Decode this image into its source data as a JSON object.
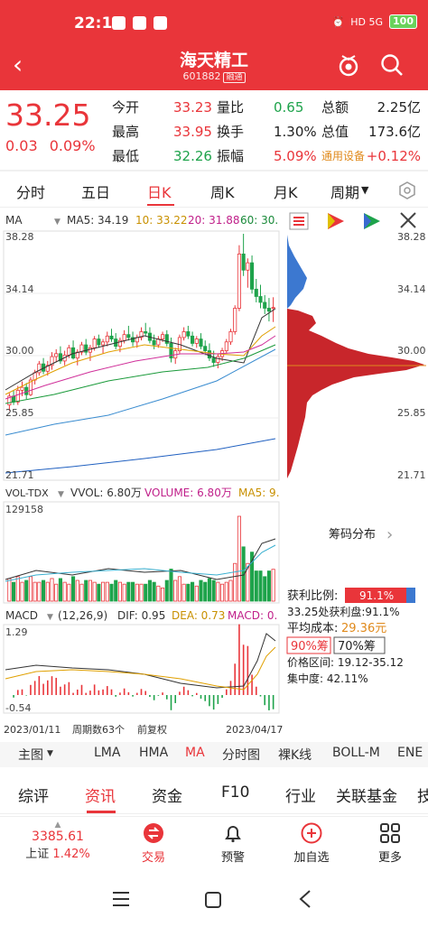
{
  "status": {
    "time": "22:19",
    "net": "HD 5G",
    "battery": "100"
  },
  "header": {
    "title": "海天精工",
    "code": "601882",
    "tag": "融通"
  },
  "quote": {
    "price": "33.25",
    "change": "0.03",
    "change_pct": "0.09%",
    "rows": [
      {
        "l1": "今开",
        "v1": "33.23",
        "l2": "量比",
        "v2": "0.65",
        "l3": "总额",
        "v3": "2.25亿"
      },
      {
        "l1": "最高",
        "v1": "33.95",
        "l2": "换手",
        "v2": "1.30%",
        "l3": "总值",
        "v3": "173.6亿"
      },
      {
        "l1": "最低",
        "v1": "32.26",
        "l2": "振幅",
        "v2": "5.09%",
        "l3": "通用设备",
        "v3": "+0.12%"
      }
    ]
  },
  "period_tabs": [
    "分时",
    "五日",
    "日K",
    "周K",
    "月K",
    "周期"
  ],
  "period_active": "日K",
  "ma_legend": {
    "label": "MA",
    "ma5": "MA5: 34.19",
    "ma10": "10: 33.22",
    "ma20": "20: 31.88",
    "ma60": "60: 30."
  },
  "price_axis": [
    "38.28",
    "34.14",
    "30.00",
    "25.85",
    "21.71"
  ],
  "vol_legend": {
    "label": "VOL-TDX",
    "vvol": "VVOL: 6.80万",
    "volume": "VOLUME: 6.80万",
    "ma5": "MA5: 9."
  },
  "vol_max": "129158",
  "macd_legend": {
    "label": "MACD",
    "params": "(12,26,9)",
    "dif": "DIF: 0.95",
    "dea": "DEA: 0.73",
    "macd": "MACD: 0."
  },
  "macd_axis": [
    "1.29",
    "-0.54"
  ],
  "date_axis": {
    "start": "2023/01/11",
    "period": "周期数63个",
    "adj": "前复权",
    "end": "2023/04/17"
  },
  "chip": {
    "title": "筹码分布",
    "ratio_label": "获利比例:",
    "ratio_value": "91.1%",
    "profit_line": "33.25处获利盘:91.1%",
    "avg_label": "平均成本:",
    "avg_value": "29.36元",
    "chip90": "90%筹",
    "chip70": "70%筹",
    "range": "价格区间: 19.12-35.12",
    "concentration": "集中度: 42.11%"
  },
  "indicator_tabs": [
    "主图",
    "LMA",
    "HMA",
    "MA",
    "分时图",
    "裸K线",
    "BOLL-M",
    "ENE"
  ],
  "indicator_active": "MA",
  "info_tabs": [
    "综评",
    "资讯",
    "资金",
    "F10",
    "行业",
    "关联基金",
    "技"
  ],
  "info_active": "资讯",
  "footer": {
    "index_value": "3385.61",
    "index_name": "上证",
    "index_pct": "1.42%",
    "items": [
      "交易",
      "预警",
      "加自选",
      "更多"
    ]
  },
  "colors": {
    "brand": "#e9353a",
    "up": "#e9353a",
    "down": "#1ea34b"
  },
  "chart_data": {
    "type": "candlestick",
    "ylim": [
      21.71,
      38.28
    ],
    "candles": [
      [
        26.6,
        27.4,
        26.2,
        27.2
      ],
      [
        27.2,
        27.6,
        26.6,
        26.8
      ],
      [
        26.8,
        27.9,
        26.6,
        27.6
      ],
      [
        27.6,
        28.2,
        27.2,
        27.8
      ],
      [
        27.8,
        28.1,
        27.0,
        27.3
      ],
      [
        27.3,
        28.5,
        27.2,
        28.3
      ],
      [
        28.3,
        29.0,
        28.0,
        28.8
      ],
      [
        28.8,
        29.6,
        28.6,
        29.4
      ],
      [
        29.4,
        29.8,
        28.7,
        28.9
      ],
      [
        28.9,
        29.6,
        28.6,
        29.3
      ],
      [
        29.3,
        30.2,
        29.0,
        29.9
      ],
      [
        29.9,
        30.4,
        29.5,
        30.1
      ],
      [
        30.1,
        30.6,
        29.4,
        29.6
      ],
      [
        29.6,
        30.3,
        29.3,
        30.0
      ],
      [
        30.0,
        30.7,
        29.8,
        30.5
      ],
      [
        30.5,
        31.0,
        29.7,
        29.8
      ],
      [
        29.8,
        30.4,
        29.3,
        30.2
      ],
      [
        30.2,
        30.9,
        30.0,
        30.7
      ],
      [
        30.7,
        31.1,
        30.0,
        30.2
      ],
      [
        30.2,
        30.7,
        29.6,
        30.5
      ],
      [
        30.5,
        31.3,
        30.3,
        31.1
      ],
      [
        31.1,
        31.4,
        30.5,
        30.7
      ],
      [
        30.7,
        31.1,
        30.1,
        30.9
      ],
      [
        30.9,
        31.6,
        30.6,
        31.3
      ],
      [
        31.3,
        31.8,
        30.9,
        31.1
      ],
      [
        31.1,
        31.5,
        30.4,
        30.6
      ],
      [
        30.6,
        31.2,
        30.2,
        31.0
      ],
      [
        31.0,
        31.7,
        30.8,
        31.4
      ],
      [
        31.4,
        32.0,
        31.0,
        31.2
      ],
      [
        31.2,
        31.6,
        30.6,
        30.9
      ],
      [
        30.9,
        31.4,
        30.5,
        31.2
      ],
      [
        31.2,
        31.9,
        31.0,
        31.6
      ],
      [
        31.6,
        32.2,
        31.3,
        31.5
      ],
      [
        31.5,
        31.9,
        30.8,
        31.0
      ],
      [
        31.0,
        31.4,
        30.4,
        30.7
      ],
      [
        30.7,
        31.3,
        30.5,
        31.1
      ],
      [
        31.1,
        31.6,
        30.9,
        31.4
      ],
      [
        31.4,
        31.7,
        30.6,
        30.8
      ],
      [
        30.8,
        31.2,
        29.5,
        29.8
      ],
      [
        29.8,
        30.5,
        29.4,
        30.3
      ],
      [
        30.3,
        31.4,
        30.1,
        31.2
      ],
      [
        31.2,
        31.9,
        31.0,
        31.6
      ],
      [
        31.6,
        32.0,
        31.1,
        31.3
      ],
      [
        31.3,
        31.6,
        30.6,
        30.8
      ],
      [
        30.8,
        31.3,
        30.5,
        31.1
      ],
      [
        31.1,
        31.5,
        30.4,
        30.6
      ],
      [
        30.6,
        31.0,
        30.0,
        30.3
      ],
      [
        30.3,
        30.8,
        29.6,
        29.8
      ],
      [
        29.8,
        30.3,
        29.2,
        29.5
      ],
      [
        29.5,
        30.1,
        29.1,
        29.9
      ],
      [
        29.9,
        30.5,
        29.6,
        30.3
      ],
      [
        30.3,
        31.1,
        30.1,
        30.9
      ],
      [
        30.9,
        31.8,
        30.7,
        31.6
      ],
      [
        31.6,
        33.4,
        31.4,
        33.2
      ],
      [
        33.2,
        37.5,
        33.0,
        36.9
      ],
      [
        36.9,
        38.28,
        35.4,
        35.8
      ],
      [
        35.8,
        36.6,
        34.6,
        36.3
      ],
      [
        36.3,
        36.8,
        34.2,
        34.5
      ],
      [
        34.5,
        35.2,
        33.6,
        34.0
      ],
      [
        34.0,
        34.8,
        33.2,
        33.6
      ],
      [
        33.6,
        34.1,
        32.8,
        33.2
      ],
      [
        33.2,
        33.9,
        32.3,
        33.0
      ],
      [
        33.23,
        33.95,
        32.26,
        33.25
      ]
    ]
  }
}
